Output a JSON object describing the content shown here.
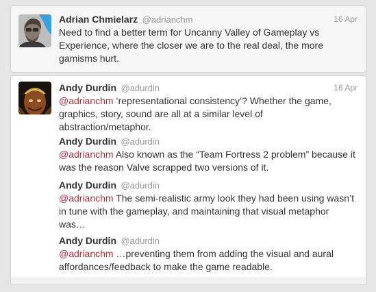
{
  "tweets": [
    {
      "name": "Adrian Chmielarz",
      "handle": "@adrianchm",
      "date": "16 Apr",
      "mention": "",
      "text": "Need to find a better term for Uncanny Valley of Gameplay vs Experience, where the closer we are to the real deal, the more gamisms hurt."
    },
    {
      "name": "Andy Durdin",
      "handle": "@adurdin",
      "date": "16 Apr",
      "mention": "@adrianchm",
      "text": " ‘representational consistency’? Whether the game, graphics, story, sound are all at a similar level of abstraction/metaphor."
    },
    {
      "name": "Andy Durdin",
      "handle": "@adurdin",
      "date": "",
      "mention": "@adrianchm",
      "text": " Also known as the “Team Fortress 2 problem” because it was the reason Valve scrapped two versions of it."
    },
    {
      "name": "Andy Durdin",
      "handle": "@adurdin",
      "date": "",
      "mention": "@adrianchm",
      "text": " The semi-realistic army look they had been using wasn’t in tune with the gameplay, and maintaining that visual metaphor was…"
    },
    {
      "name": "Andy Durdin",
      "handle": "@adurdin",
      "date": "",
      "mention": "@adrianchm",
      "text": " …preventing them from adding the visual and aural affordances/feedback to make the game readable."
    }
  ]
}
